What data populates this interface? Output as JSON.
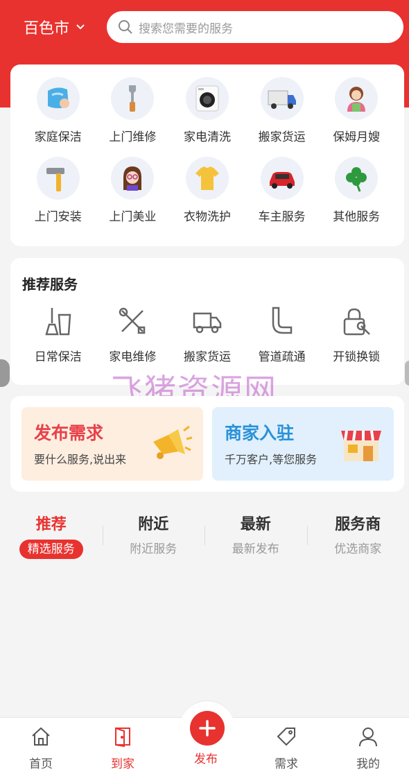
{
  "header": {
    "city": "百色市",
    "search_placeholder": "搜索您需要的服务"
  },
  "categories": [
    {
      "label": "家庭保洁",
      "icon": "cleaning-cloth-icon"
    },
    {
      "label": "上门维修",
      "icon": "wrench-icon"
    },
    {
      "label": "家电清洗",
      "icon": "washing-machine-icon"
    },
    {
      "label": "搬家货运",
      "icon": "truck-icon"
    },
    {
      "label": "保姆月嫂",
      "icon": "nanny-icon"
    },
    {
      "label": "上门安装",
      "icon": "hammer-icon"
    },
    {
      "label": "上门美业",
      "icon": "beauty-girl-icon"
    },
    {
      "label": "衣物洗护",
      "icon": "tshirt-icon"
    },
    {
      "label": "车主服务",
      "icon": "car-icon"
    },
    {
      "label": "其他服务",
      "icon": "clover-icon"
    }
  ],
  "recommend": {
    "title": "推荐服务",
    "items": [
      {
        "label": "日常保洁",
        "icon": "broom-bucket-icon"
      },
      {
        "label": "家电维修",
        "icon": "tools-icon"
      },
      {
        "label": "搬家货运",
        "icon": "truck-outline-icon"
      },
      {
        "label": "管道疏通",
        "icon": "pipe-icon"
      },
      {
        "label": "开锁换锁",
        "icon": "lock-wrench-icon"
      }
    ]
  },
  "watermark": "飞猪资源网",
  "promos": {
    "post": {
      "title": "发布需求",
      "subtitle": "要什么服务,说出来"
    },
    "merchant": {
      "title": "商家入驻",
      "subtitle": "千万客户,等您服务"
    }
  },
  "tabs": [
    {
      "name": "推荐",
      "sub": "精选服务",
      "active": true
    },
    {
      "name": "附近",
      "sub": "附近服务"
    },
    {
      "name": "最新",
      "sub": "最新发布"
    },
    {
      "name": "服务商",
      "sub": "优选商家"
    }
  ],
  "bottom_nav": [
    {
      "label": "首页",
      "icon": "home-icon"
    },
    {
      "label": "到家",
      "icon": "door-icon",
      "active": true
    },
    {
      "label": "发布",
      "icon": "plus-icon"
    },
    {
      "label": "需求",
      "icon": "tag-icon"
    },
    {
      "label": "我的",
      "icon": "user-icon"
    }
  ],
  "colors": {
    "brand_red": "#e8322f",
    "merchant_blue": "#2a92d8"
  }
}
